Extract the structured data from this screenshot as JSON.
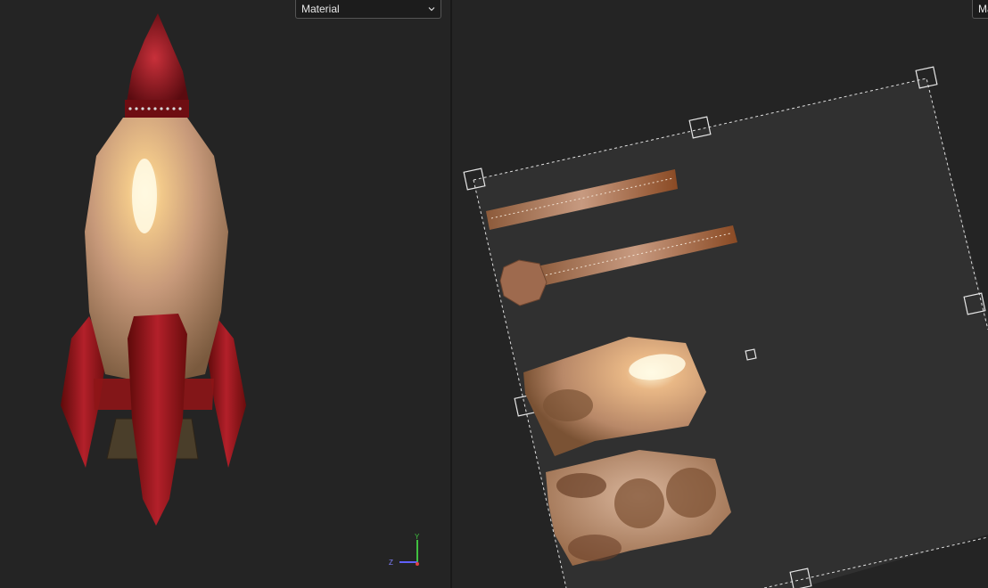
{
  "viewport_3d": {
    "material_dropdown": {
      "selected": "Material"
    },
    "axis_gizmo": {
      "y_label": "Y",
      "z_label": "Z",
      "x_color": "#e04040",
      "y_color": "#40c040",
      "z_color": "#6060ff"
    },
    "rocket_colors": {
      "body": "#c9a27c",
      "fins": "#9e1a1a",
      "nose": "#a0151b"
    }
  },
  "viewport_uv": {
    "material_dropdown": {
      "selected": "Ma"
    },
    "uv_islands": [
      "strip-top",
      "strip-bottom",
      "body-front",
      "body-back"
    ]
  }
}
